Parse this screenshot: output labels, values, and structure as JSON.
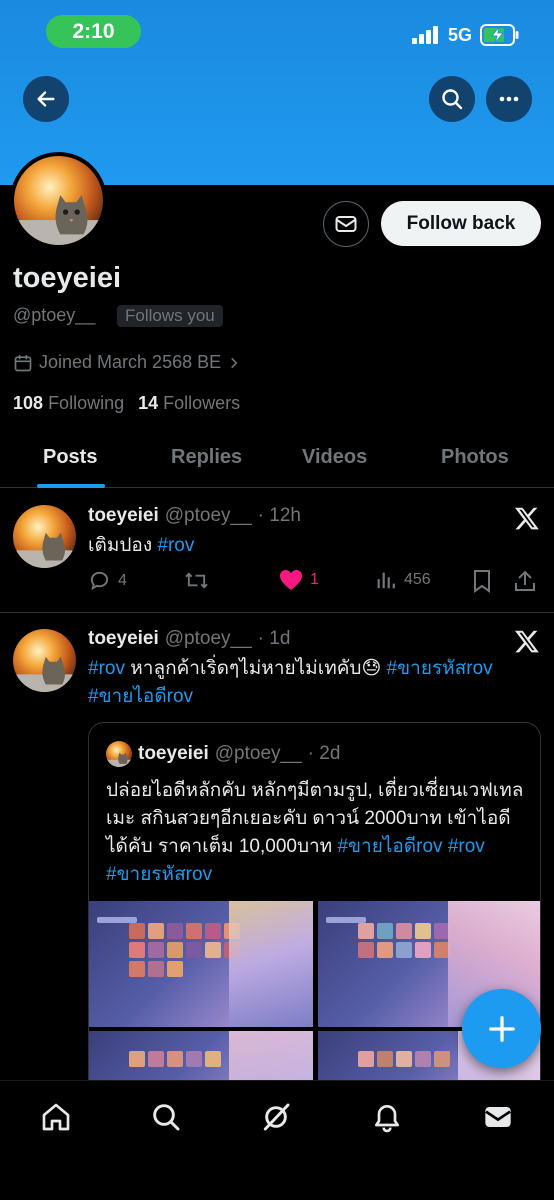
{
  "status_bar": {
    "time": "2:10",
    "network": "5G"
  },
  "profile": {
    "display_name": "toeyeiei",
    "handle": "@ptoey__",
    "follows_you": "Follows you",
    "joined": "Joined March 2568 BE",
    "following_count": "108",
    "following_label": "Following",
    "followers_count": "14",
    "followers_label": "Followers",
    "follow_back_label": "Follow back"
  },
  "tabs": [
    {
      "label": "Posts",
      "active": true
    },
    {
      "label": "Replies"
    },
    {
      "label": "Videos"
    },
    {
      "label": "Photos"
    }
  ],
  "posts": [
    {
      "name": "toeyeiei",
      "handle": "@ptoey__",
      "time": "· 12h",
      "text": "เติมปอง",
      "tag": "#rov",
      "replies": "4",
      "likes": "1",
      "views": "456"
    },
    {
      "name": "toeyeiei",
      "handle": "@ptoey__",
      "time": "· 1d",
      "tag1": "#rov",
      "text1": " หาลูกค้าเริ่ดๆไม่หายไม่เทคับ",
      "emoji": "😓",
      "tag2": "#ขายรหัสrov",
      "tag3": "#ขายไอดีrov",
      "quote": {
        "name": "toeyeiei",
        "handle": "@ptoey__",
        "time": "· 2d",
        "text": "ปล่อยไอดีหลักคับ หลักๆมีตามรูป, เตี่ยวเซี่ยนเวฟเทลเมะ สกินสวยๆอีกเยอะคับ ดาวน์ 2000บาท เข้าไอดีได้คับ ราคาเต็ม 10,000บาท ",
        "tag1": "#ขายไอดีrov",
        "tag2": "#rov",
        "tag3": "#ขายรหัสrov"
      }
    }
  ],
  "nav": [
    "home-icon",
    "search-icon",
    "grok-icon",
    "notifications-icon",
    "messages-icon"
  ],
  "colors": {
    "accent": "#1d9bf0",
    "like": "#f91880",
    "banner": "#1d93e8"
  }
}
